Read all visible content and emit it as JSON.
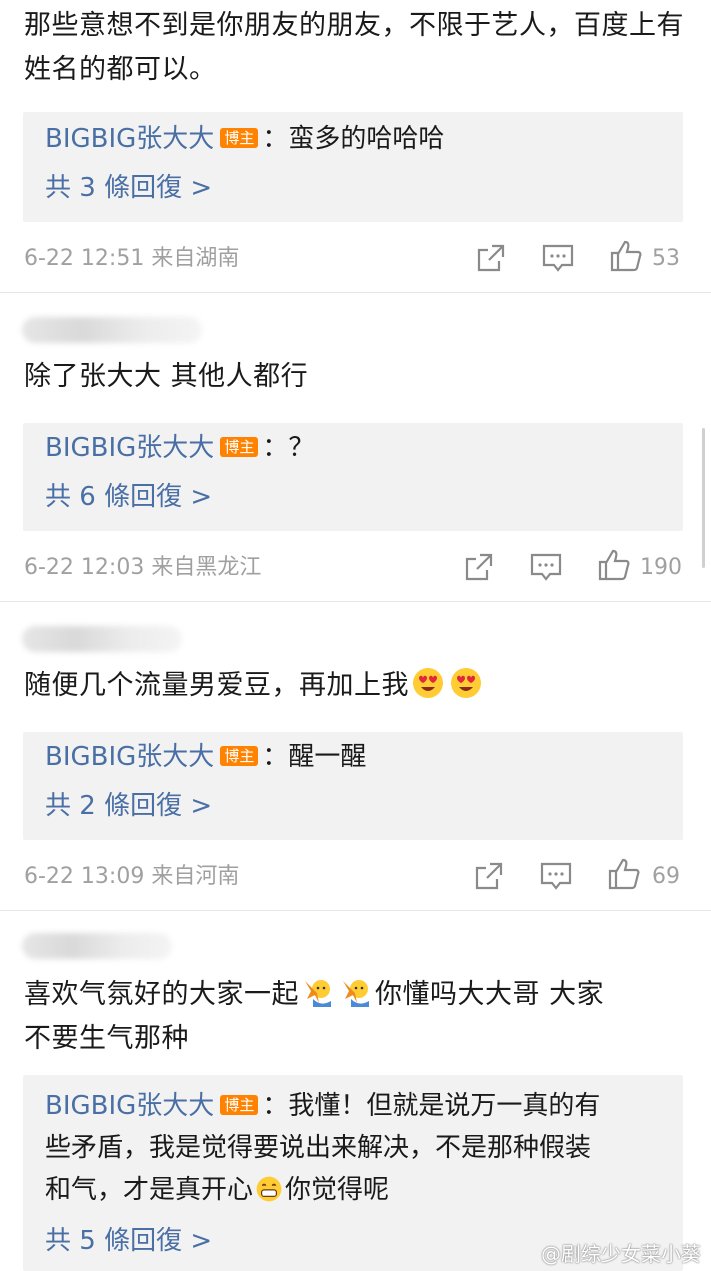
{
  "comments": [
    {
      "text": "那些意想不到是你朋友的朋友，不限于艺人，百度上有姓名的都可以。",
      "reply": {
        "author": "BIGBIG张大大",
        "badge": "博主",
        "content": "：蛮多的哈哈哈"
      },
      "more": "共 3 條回復 >",
      "meta": "6-22 12:51  来自湖南",
      "likes": "53"
    },
    {
      "text": "除了张大大 其他人都行",
      "reply": {
        "author": "BIGBIG张大大",
        "badge": "博主",
        "content": "：？"
      },
      "more": "共 6 條回復 >",
      "meta": "6-22 12:03  来自黑龙江",
      "likes": "190"
    },
    {
      "text": "随便几个流量男爱豆，再加上我",
      "reply": {
        "author": "BIGBIG张大大",
        "badge": "博主",
        "content": "：醒一醒"
      },
      "more": "共 2 條回復 >",
      "meta": "6-22 13:09  来自河南",
      "likes": "69"
    },
    {
      "text_a": "喜欢气氛好的大家一起",
      "text_b": "你懂吗大大哥 大家",
      "text_c": "不要生气那种",
      "reply": {
        "author": "BIGBIG张大大",
        "badge": "博主",
        "content_a": "：我懂！但就是说万一真的有",
        "content_b": "些矛盾，我是觉得要说出来解决，不是那种假装",
        "content_c": "和气，才是真开心",
        "content_d": "你觉得呢"
      },
      "more": "共 5 條回復 >"
    }
  ],
  "watermark": "@剧综少女菜小葵",
  "colors": {
    "link": "#4a6fa5",
    "badge": "#ff8200",
    "reply_bg": "#f2f2f2",
    "meta": "#a0a0a0"
  }
}
